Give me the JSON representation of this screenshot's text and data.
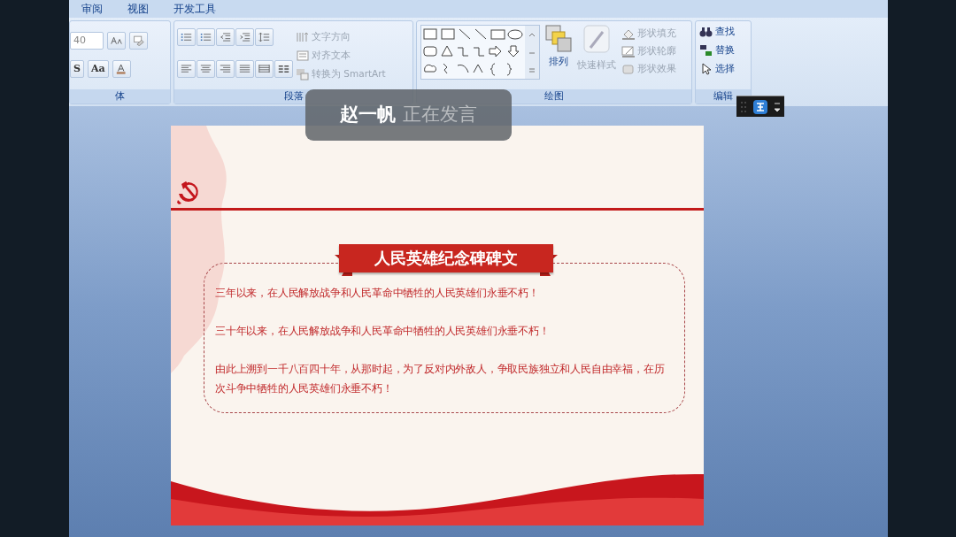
{
  "ribbon_tabs": [
    {
      "label": "审阅",
      "selected": false
    },
    {
      "label": "视图",
      "selected": false
    },
    {
      "label": "开发工具",
      "selected": false
    }
  ],
  "font_group": {
    "label": "体",
    "font_size": "40",
    "buttons": [
      "S",
      "Aa"
    ]
  },
  "paragraph_group": {
    "label": "段落",
    "commands": [
      {
        "label": "文字方向",
        "disabled": true
      },
      {
        "label": "对齐文本",
        "disabled": true
      },
      {
        "label": "转换为 SmartArt",
        "disabled": true
      }
    ]
  },
  "drawing_group": {
    "label": "绘图",
    "arrange": {
      "label": "排列",
      "disabled": false
    },
    "quick_styles": {
      "label": "快速样式",
      "disabled": true
    },
    "commands": [
      {
        "label": "形状填充",
        "disabled": true
      },
      {
        "label": "形状轮廓",
        "disabled": true
      },
      {
        "label": "形状效果",
        "disabled": true
      }
    ]
  },
  "editing_group": {
    "label": "编辑",
    "commands": [
      {
        "label": "查找",
        "disabled": false
      },
      {
        "label": "替换",
        "disabled": false
      },
      {
        "label": "选择",
        "disabled": false
      }
    ]
  },
  "speaker_overlay": {
    "name": "赵一帆",
    "status": "正在发言"
  },
  "slide": {
    "title": "人民英雄纪念碑碑文",
    "paragraphs": [
      "三年以来，在人民解放战争和人民革命中牺牲的人民英雄们永垂不朽！",
      "三十年以来，在人民解放战争和人民革命中牺牲的人民英雄们永垂不朽！",
      "由此上溯到一千八百四十年，从那时起，为了反对内外敌人，争取民族独立和人民自由幸福，在历次斗争中牺牲的人民英雄们永垂不朽！"
    ]
  }
}
